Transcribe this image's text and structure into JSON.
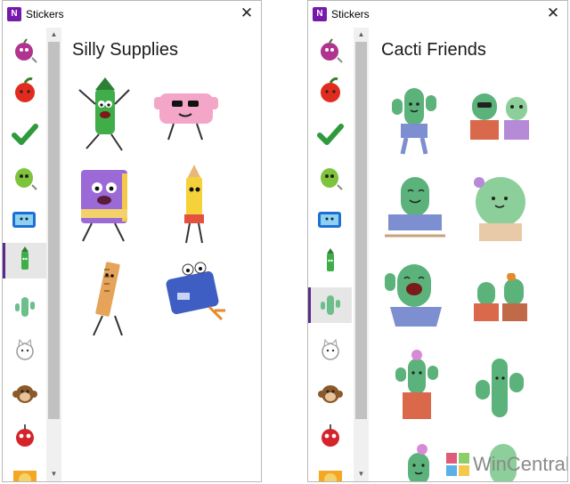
{
  "left_window": {
    "title": "Stickers",
    "app_icon": "N",
    "pack_title": "Silly Supplies",
    "categories": [
      "grape-icon",
      "apple-icon",
      "checkmark-icon",
      "pepper-icon",
      "tablet-icon",
      "crayon-icon",
      "cactus-icon",
      "cat-icon",
      "monkey-icon",
      "robot-icon",
      "comic-icon"
    ],
    "stickers": [
      "green-crayon-sticker",
      "pink-eraser-sticker",
      "purple-notebook-sticker",
      "yellow-pencil-sticker",
      "ruler-sticker",
      "pencil-sharpener-sticker"
    ]
  },
  "right_window": {
    "title": "Stickers",
    "app_icon": "N",
    "pack_title": "Cacti Friends",
    "categories": [
      "grape-icon",
      "apple-icon",
      "checkmark-icon",
      "pepper-icon",
      "tablet-icon",
      "crayon-icon",
      "cactus-icon",
      "cat-icon",
      "monkey-icon",
      "robot-icon",
      "comic-icon"
    ],
    "stickers": [
      "blue-pot-cactus-sticker",
      "two-cacti-sticker",
      "happy-cactus-sticker",
      "flower-cactus-sticker",
      "laughing-cactus-sticker",
      "cactus-pair-sticker",
      "pink-flower-cactus-sticker",
      "prickly-cactus-sticker",
      "small-cactus-sticker",
      "tall-cactus-sticker"
    ]
  },
  "watermark": {
    "text": "WinCentral"
  },
  "colors": {
    "accent": "#5b2a8a",
    "app_icon": "#7719aa"
  }
}
